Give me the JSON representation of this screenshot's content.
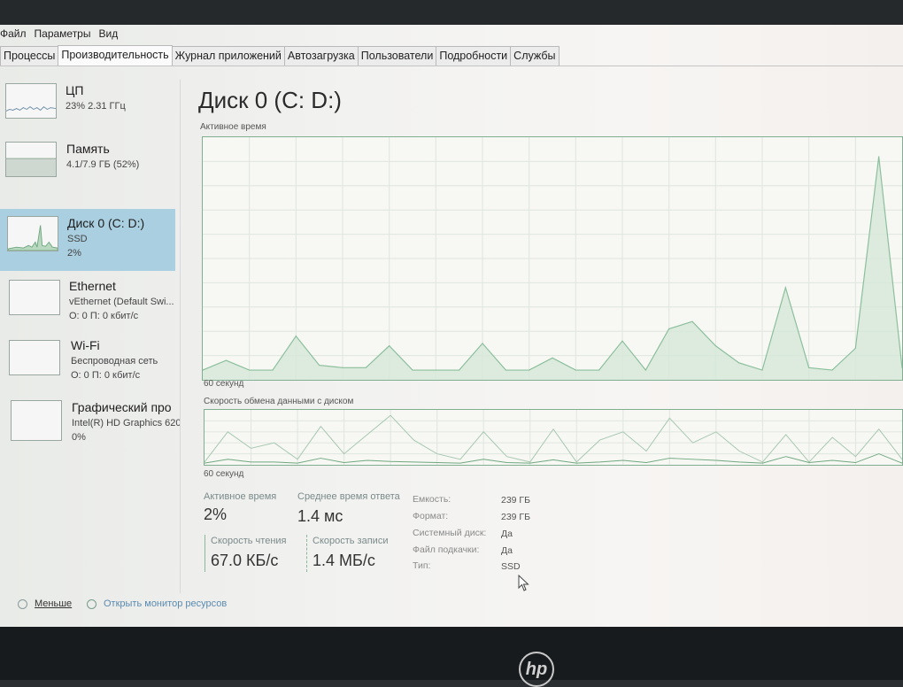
{
  "menu": [
    "Файл",
    "Параметры",
    "Вид"
  ],
  "tabs": [
    {
      "label": "Процессы",
      "active": false
    },
    {
      "label": "Производительность",
      "active": true
    },
    {
      "label": "Журнал приложений",
      "active": false
    },
    {
      "label": "Автозагрузка",
      "active": false
    },
    {
      "label": "Пользователи",
      "active": false
    },
    {
      "label": "Подробности",
      "active": false
    },
    {
      "label": "Службы",
      "active": false
    }
  ],
  "sidebar": {
    "cpu": {
      "title": "ЦП",
      "line1": "23% 2.31 ГГц"
    },
    "memory": {
      "title": "Память",
      "line1": "4.1/7.9 ГБ (52%)",
      "fill_percent": 52
    },
    "disk": {
      "title": "Диск 0 (C: D:)",
      "line1": "SSD",
      "line2": "2%"
    },
    "ethernet": {
      "title": "Ethernet",
      "line1": "vEthernet (Default Swi...",
      "line2": "О: 0 П: 0 кбит/с"
    },
    "wifi": {
      "title": "Wi-Fi",
      "line1": "Беспроводная сеть",
      "line2": "О: 0 П: 0 кбит/с"
    },
    "gpu": {
      "title": "Графический про",
      "line1": "Intel(R) HD Graphics 620",
      "line2": "0%"
    }
  },
  "main": {
    "title": "Диск 0 (C: D:)",
    "chart1_label": "Активное время",
    "chart1_time": "60 секунд",
    "chart2_label": "Скорость обмена данными с диском",
    "chart2_time": "60 секунд"
  },
  "stats": {
    "active_label": "Активное время",
    "active_value": "2%",
    "response_label": "Среднее время ответа",
    "response_value": "1.4 мс",
    "read_label": "Скорость чтения",
    "read_value": "67.0 КБ/с",
    "write_label": "Скорость записи",
    "write_value": "1.4 МБ/с"
  },
  "info": [
    {
      "key": "Емкость:",
      "value": "239 ГБ"
    },
    {
      "key": "Формат:",
      "value": "239 ГБ"
    },
    {
      "key": "Системный диск:",
      "value": "Да"
    },
    {
      "key": "Файл подкачки:",
      "value": "Да"
    },
    {
      "key": "Тип:",
      "value": "SSD"
    }
  ],
  "footer": {
    "less_label": "Меньше",
    "monitor_label": "Открыть монитор ресурсов"
  },
  "brand": "hp",
  "colors": {
    "accent": "#8bbf9c",
    "selection": "#a9cfe0",
    "fill": "#d4e7d8"
  },
  "chart_data": [
    {
      "type": "area",
      "title": "Активное время",
      "xlabel": "60 секунд",
      "x": [
        60,
        58,
        56,
        54,
        52,
        50,
        48,
        46,
        44,
        42,
        40,
        38,
        36,
        34,
        32,
        30,
        28,
        26,
        24,
        22,
        20,
        18,
        16,
        14,
        12,
        10,
        8,
        6,
        4,
        2,
        0
      ],
      "ylim": [
        0,
        100
      ],
      "values": [
        4,
        8,
        4,
        4,
        18,
        6,
        5,
        5,
        14,
        4,
        4,
        4,
        15,
        4,
        4,
        9,
        4,
        4,
        16,
        4,
        21,
        24,
        14,
        7,
        4,
        38,
        5,
        4,
        13,
        92,
        5
      ]
    },
    {
      "type": "line",
      "title": "Скорость обмена данными с диском",
      "xlabel": "60 секунд",
      "x": [
        60,
        58,
        56,
        54,
        52,
        50,
        48,
        46,
        44,
        42,
        40,
        38,
        36,
        34,
        32,
        30,
        28,
        26,
        24,
        22,
        20,
        18,
        16,
        14,
        12,
        10,
        8,
        6,
        4,
        2,
        0
      ],
      "ylim": [
        0,
        100
      ],
      "series": [
        {
          "values": [
            5,
            60,
            30,
            40,
            10,
            70,
            20,
            55,
            90,
            45,
            20,
            10,
            60,
            15,
            5,
            65,
            5,
            45,
            60,
            25,
            85,
            40,
            60,
            25,
            5,
            55,
            5,
            50,
            15,
            65,
            10
          ]
        },
        {
          "values": [
            3,
            10,
            5,
            5,
            3,
            12,
            4,
            8,
            6,
            5,
            4,
            3,
            10,
            4,
            3,
            9,
            3,
            5,
            8,
            4,
            12,
            10,
            8,
            5,
            3,
            15,
            4,
            8,
            4,
            20,
            3
          ]
        }
      ]
    }
  ]
}
